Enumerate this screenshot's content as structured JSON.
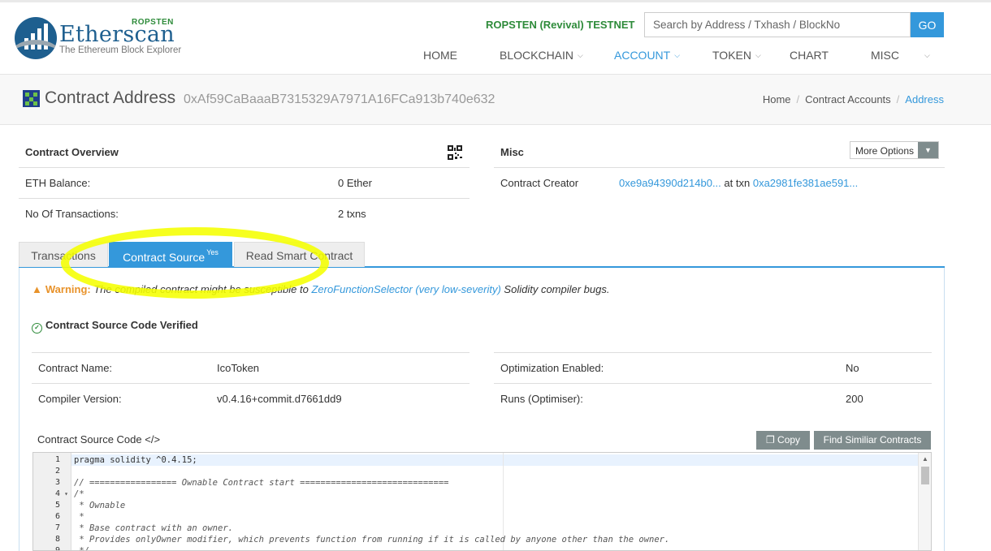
{
  "header": {
    "logo_name": "Etherscan",
    "logo_network": "ROPSTEN",
    "logo_tagline": "The Ethereum Block Explorer",
    "testnet_label": "ROPSTEN (Revival) TESTNET",
    "search_placeholder": "Search by Address / Txhash / BlockNo",
    "go_label": "GO",
    "nav": [
      {
        "label": "HOME"
      },
      {
        "label": "BLOCKCHAIN"
      },
      {
        "label": "ACCOUNT"
      },
      {
        "label": "TOKEN"
      },
      {
        "label": "CHART"
      },
      {
        "label": "MISC"
      }
    ]
  },
  "page": {
    "title": "Contract Address",
    "address": "0xAf59CaBaaaB7315329A7971A16FCa913b740e632",
    "breadcrumb": [
      "Home",
      "Contract Accounts",
      "Address"
    ]
  },
  "overview": {
    "title": "Contract Overview",
    "rows": [
      {
        "label": "ETH Balance:",
        "value": "0 Ether"
      },
      {
        "label": "No Of Transactions:",
        "value": "2 txns"
      }
    ]
  },
  "misc": {
    "title": "Misc",
    "more_options": "More Options",
    "creator_label": "Contract Creator",
    "creator_address": "0xe9a94390d214b0...",
    "at_txn": "at txn",
    "creator_txn": "0xa2981fe381ae591..."
  },
  "tabs": [
    {
      "label": "Transactions"
    },
    {
      "label": "Contract Source",
      "badge": "Yes"
    },
    {
      "label": "Read Smart Contract"
    }
  ],
  "source": {
    "warning_label": "Warning:",
    "warning_text": "The compiled contract might be susceptible to",
    "warning_link": "ZeroFunctionSelector (very low-severity)",
    "warning_tail": "Solidity compiler bugs.",
    "verified_label": "Contract Source Code Verified",
    "details": {
      "contract_name_label": "Contract Name:",
      "contract_name": "IcoToken",
      "compiler_label": "Compiler Version:",
      "compiler": "v0.4.16+commit.d7661dd9",
      "optimization_label": "Optimization Enabled:",
      "optimization": "No",
      "runs_label": "Runs (Optimiser):",
      "runs": "200"
    },
    "code_label": "Contract Source Code </>",
    "copy_label": "Copy",
    "similar_label": "Find Similiar Contracts",
    "code_lines": [
      "pragma solidity ^0.4.15;",
      "",
      "// ================= Ownable Contract start =============================",
      "/*",
      " * Ownable",
      " *",
      " * Base contract with an owner.",
      " * Provides onlyOwner modifier, which prevents function from running if it is called by anyone other than the owner.",
      " */"
    ]
  }
}
